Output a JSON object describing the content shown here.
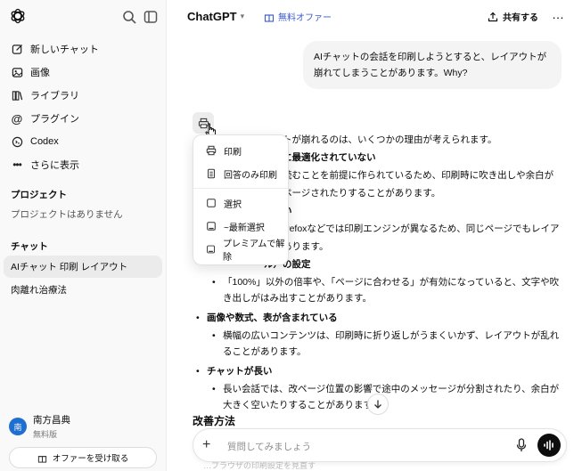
{
  "sidebar": {
    "nav": [
      {
        "label": "新しいチャット",
        "icon": "compose-icon"
      },
      {
        "label": "画像",
        "icon": "image-icon"
      },
      {
        "label": "ライブラリ",
        "icon": "library-icon"
      },
      {
        "label": "プラグイン",
        "icon": "at-icon"
      },
      {
        "label": "Codex",
        "icon": "codex-icon"
      },
      {
        "label": "さらに表示",
        "icon": "more-icon"
      }
    ],
    "projects_title": "プロジェクト",
    "projects_empty": "プロジェクトはありません",
    "chats_title": "チャット",
    "chats": [
      {
        "label": "AIチャット 印刷 レイアウト",
        "active": true
      },
      {
        "label": "肉離れ治療法",
        "active": false
      }
    ],
    "user": {
      "initial": "南",
      "name": "南方昌典",
      "plan": "無料版"
    },
    "offer_button": "オファーを受け取る"
  },
  "header": {
    "title": "ChatGPT",
    "promo": "無料オファー",
    "share": "共有する",
    "more": "…"
  },
  "conversation": {
    "user_message": "AIチャットの会話を印刷しようとすると、レイアウトが崩れてしまうことがあります。Why?",
    "answer_lines": [
      {
        "type": "p",
        "text": "アウトが崩れるのは、いくつかの理由が考えられます。"
      },
      {
        "type": "bold",
        "text": "向けに最適化されていない"
      },
      {
        "type": "plain",
        "text": "面で読むことを前提に作られているため、印刷時に吹き出しや余白が"
      },
      {
        "type": "plain",
        "text": "で改ページされたりすることがあります。"
      },
      {
        "type": "bold",
        "text": "の違い"
      },
      {
        "type": "plain",
        "text": "e、Firefoxなどでは印刷エンジンが異なるため、同じページでもレイア"
      },
      {
        "type": "plain",
        "text": "とがあります。"
      },
      {
        "type": "bold",
        "text": "ル）の設定"
      }
    ],
    "sections": [
      {
        "bullet": "",
        "items": [
          "「100%」以外の倍率や、「ページに合わせる」が有効になっていると、文字や吹き出しがはみ出すことがあります。"
        ]
      },
      {
        "bullet": "画像や数式、表が含まれている",
        "items": [
          "横幅の広いコンテンツは、印刷時に折り返しがうまくいかず、レイアウトが乱れることがあります。"
        ]
      },
      {
        "bullet": "チャットが長い",
        "items": [
          "長い会話では、改ページ位置の影響で途中のメッセージが分割されたり、余白が大きく空いたりすることがあります。"
        ]
      }
    ],
    "next_heading": "改善方法",
    "faded_text": "…ブラウザの印刷設定を見直す"
  },
  "print_menu": {
    "items": [
      {
        "label": "印刷",
        "icon": "printer-icon"
      },
      {
        "label": "回答のみ印刷",
        "icon": "document-print-icon"
      },
      {
        "label": "選択",
        "icon": "checkbox-icon"
      },
      {
        "label": "~最新選択",
        "icon": "bookmark-icon"
      },
      {
        "label": "プレミアムで解除",
        "icon": "bookmark-icon"
      }
    ]
  },
  "composer": {
    "placeholder": "質問してみましょう"
  }
}
